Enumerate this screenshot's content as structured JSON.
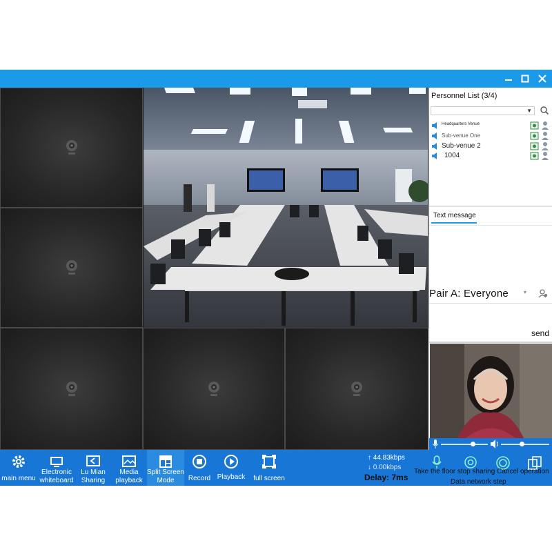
{
  "window": {
    "minimize_icon": "minimize-icon",
    "maximize_icon": "maximize-icon",
    "close_icon": "close-icon"
  },
  "personnel": {
    "title": "Personnel List (3/4)",
    "items": [
      {
        "name": "Headquarters Venue"
      },
      {
        "name": "Sub-venue One"
      },
      {
        "name": "Sub-venue 2"
      },
      {
        "name": "1004"
      }
    ]
  },
  "text_message": {
    "tab_label": "Text message",
    "recipient": "Pair A: Everyone",
    "send_label": "send"
  },
  "toolbar": {
    "items": [
      {
        "label": "main menu",
        "icon": "gear-icon"
      },
      {
        "label": "Electronic whiteboard",
        "icon": "whiteboard-icon"
      },
      {
        "label": "Lu Mian Sharing",
        "icon": "share-icon"
      },
      {
        "label": "Media playback",
        "icon": "media-icon"
      },
      {
        "label": "Split Screen Mode",
        "icon": "split-screen-icon"
      },
      {
        "label": "Record",
        "icon": "record-icon"
      },
      {
        "label": "Playback",
        "icon": "play-icon"
      },
      {
        "label": "full screen",
        "icon": "fullscreen-icon"
      }
    ],
    "upload": "44.83kbps",
    "download": "0.00kbps",
    "delay": "Delay: 7ms",
    "actions": [
      {
        "label": "Take the floor",
        "icon": "microphone-icon"
      },
      {
        "label": "stop sharing",
        "icon": "stop-sharing-icon"
      },
      {
        "label": "Cancel operation",
        "icon": "cancel-icon"
      },
      {
        "label": "Data network step",
        "icon": "network-step-icon"
      }
    ]
  },
  "colors": {
    "accent": "#1a9ae8",
    "toolbar": "#1877d6"
  }
}
